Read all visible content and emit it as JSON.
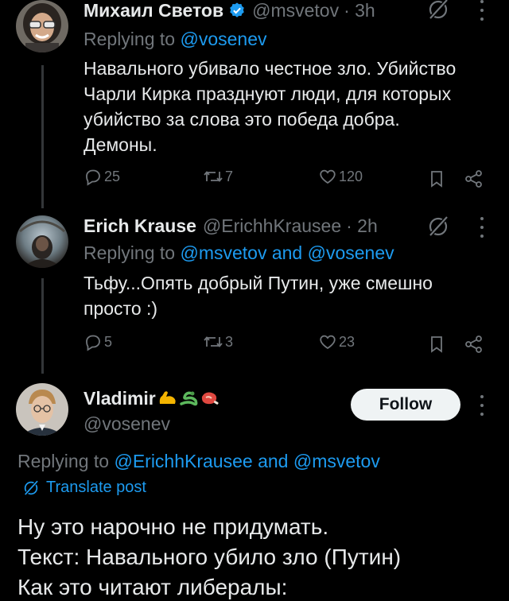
{
  "tweets": [
    {
      "name": "Михаил Светов",
      "verified": true,
      "handle": "@msvetov",
      "time": "· 3h",
      "replying_prefix": "Replying to",
      "replying_to": "@vosenev",
      "text_lines": [
        "Навального убивало честное зло. Убийство",
        "Чарли Кирка празднуют люди, для которых",
        "убийство за слова это победа добра.",
        "Демоны."
      ],
      "replies": "25",
      "reposts": "7",
      "likes": "120"
    },
    {
      "name": "Erich Krause",
      "handle": "@ErichhKrausee",
      "time": "· 2h",
      "replying_prefix": "Replying to",
      "replying_to_1": "@msvetov",
      "replying_and": "and",
      "replying_to_2": "@vosenev",
      "text_lines": [
        "Тьфу...Опять добрый Путин, уже смешно",
        "просто :)"
      ],
      "replies": "5",
      "reposts": "3",
      "likes": "23"
    }
  ],
  "main_post": {
    "name": "Vladimir",
    "name_emojis": [
      "flexed-biceps",
      "snake",
      "meat"
    ],
    "handle": "@vosenev",
    "follow_label": "Follow",
    "replying_prefix": "Replying to",
    "replying_to_1": "@ErichhKrausee",
    "replying_and": "and",
    "replying_to_2": "@msvetov",
    "translate_label": "Translate post",
    "text_lines": [
      "Ну это нарочно не придумать.",
      "Текст: Навального убило зло (Путин)",
      "Как это читают либералы:"
    ]
  },
  "colors": {
    "background": "#000000",
    "text": "#e7e9ea",
    "muted": "#71767b",
    "link": "#1d9bf0",
    "verified": "#1d9bf0",
    "follow_bg": "#eff3f4"
  }
}
